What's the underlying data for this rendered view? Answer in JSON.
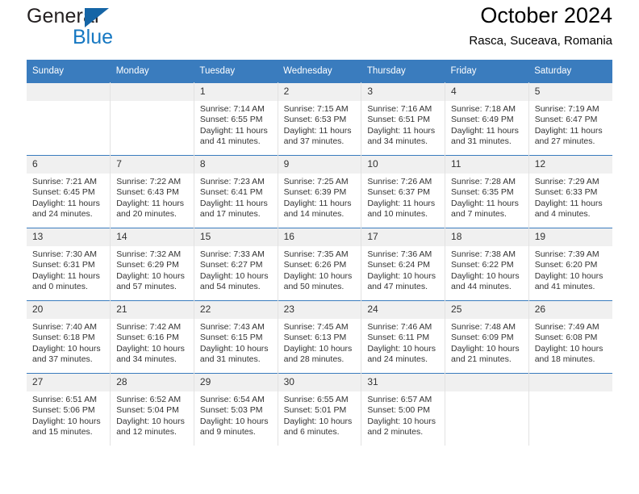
{
  "brand": {
    "name_top": "General",
    "name_bottom": "Blue",
    "triangle_color": "#1565a6",
    "blue_color": "#1678c2"
  },
  "header": {
    "title": "October 2024",
    "subtitle": "Rasca, Suceava, Romania"
  },
  "theme": {
    "header_bg": "#3a7cbe",
    "daynum_bg": "#f0f0f0",
    "cell_border": "#e2e2e2",
    "week_rule": "#3a7cbe"
  },
  "calendar": {
    "weekday_headers": [
      "Sunday",
      "Monday",
      "Tuesday",
      "Wednesday",
      "Thursday",
      "Friday",
      "Saturday"
    ],
    "labels": {
      "sunrise": "Sunrise:",
      "sunset": "Sunset:",
      "daylight": "Daylight:"
    },
    "weeks": [
      [
        {
          "day": "",
          "sunrise": "",
          "sunset": "",
          "daylight_line1": "",
          "daylight_line2": ""
        },
        {
          "day": "",
          "sunrise": "",
          "sunset": "",
          "daylight_line1": "",
          "daylight_line2": ""
        },
        {
          "day": "1",
          "sunrise": "Sunrise: 7:14 AM",
          "sunset": "Sunset: 6:55 PM",
          "daylight_line1": "Daylight: 11 hours",
          "daylight_line2": "and 41 minutes."
        },
        {
          "day": "2",
          "sunrise": "Sunrise: 7:15 AM",
          "sunset": "Sunset: 6:53 PM",
          "daylight_line1": "Daylight: 11 hours",
          "daylight_line2": "and 37 minutes."
        },
        {
          "day": "3",
          "sunrise": "Sunrise: 7:16 AM",
          "sunset": "Sunset: 6:51 PM",
          "daylight_line1": "Daylight: 11 hours",
          "daylight_line2": "and 34 minutes."
        },
        {
          "day": "4",
          "sunrise": "Sunrise: 7:18 AM",
          "sunset": "Sunset: 6:49 PM",
          "daylight_line1": "Daylight: 11 hours",
          "daylight_line2": "and 31 minutes."
        },
        {
          "day": "5",
          "sunrise": "Sunrise: 7:19 AM",
          "sunset": "Sunset: 6:47 PM",
          "daylight_line1": "Daylight: 11 hours",
          "daylight_line2": "and 27 minutes."
        }
      ],
      [
        {
          "day": "6",
          "sunrise": "Sunrise: 7:21 AM",
          "sunset": "Sunset: 6:45 PM",
          "daylight_line1": "Daylight: 11 hours",
          "daylight_line2": "and 24 minutes."
        },
        {
          "day": "7",
          "sunrise": "Sunrise: 7:22 AM",
          "sunset": "Sunset: 6:43 PM",
          "daylight_line1": "Daylight: 11 hours",
          "daylight_line2": "and 20 minutes."
        },
        {
          "day": "8",
          "sunrise": "Sunrise: 7:23 AM",
          "sunset": "Sunset: 6:41 PM",
          "daylight_line1": "Daylight: 11 hours",
          "daylight_line2": "and 17 minutes."
        },
        {
          "day": "9",
          "sunrise": "Sunrise: 7:25 AM",
          "sunset": "Sunset: 6:39 PM",
          "daylight_line1": "Daylight: 11 hours",
          "daylight_line2": "and 14 minutes."
        },
        {
          "day": "10",
          "sunrise": "Sunrise: 7:26 AM",
          "sunset": "Sunset: 6:37 PM",
          "daylight_line1": "Daylight: 11 hours",
          "daylight_line2": "and 10 minutes."
        },
        {
          "day": "11",
          "sunrise": "Sunrise: 7:28 AM",
          "sunset": "Sunset: 6:35 PM",
          "daylight_line1": "Daylight: 11 hours",
          "daylight_line2": "and 7 minutes."
        },
        {
          "day": "12",
          "sunrise": "Sunrise: 7:29 AM",
          "sunset": "Sunset: 6:33 PM",
          "daylight_line1": "Daylight: 11 hours",
          "daylight_line2": "and 4 minutes."
        }
      ],
      [
        {
          "day": "13",
          "sunrise": "Sunrise: 7:30 AM",
          "sunset": "Sunset: 6:31 PM",
          "daylight_line1": "Daylight: 11 hours",
          "daylight_line2": "and 0 minutes."
        },
        {
          "day": "14",
          "sunrise": "Sunrise: 7:32 AM",
          "sunset": "Sunset: 6:29 PM",
          "daylight_line1": "Daylight: 10 hours",
          "daylight_line2": "and 57 minutes."
        },
        {
          "day": "15",
          "sunrise": "Sunrise: 7:33 AM",
          "sunset": "Sunset: 6:27 PM",
          "daylight_line1": "Daylight: 10 hours",
          "daylight_line2": "and 54 minutes."
        },
        {
          "day": "16",
          "sunrise": "Sunrise: 7:35 AM",
          "sunset": "Sunset: 6:26 PM",
          "daylight_line1": "Daylight: 10 hours",
          "daylight_line2": "and 50 minutes."
        },
        {
          "day": "17",
          "sunrise": "Sunrise: 7:36 AM",
          "sunset": "Sunset: 6:24 PM",
          "daylight_line1": "Daylight: 10 hours",
          "daylight_line2": "and 47 minutes."
        },
        {
          "day": "18",
          "sunrise": "Sunrise: 7:38 AM",
          "sunset": "Sunset: 6:22 PM",
          "daylight_line1": "Daylight: 10 hours",
          "daylight_line2": "and 44 minutes."
        },
        {
          "day": "19",
          "sunrise": "Sunrise: 7:39 AM",
          "sunset": "Sunset: 6:20 PM",
          "daylight_line1": "Daylight: 10 hours",
          "daylight_line2": "and 41 minutes."
        }
      ],
      [
        {
          "day": "20",
          "sunrise": "Sunrise: 7:40 AM",
          "sunset": "Sunset: 6:18 PM",
          "daylight_line1": "Daylight: 10 hours",
          "daylight_line2": "and 37 minutes."
        },
        {
          "day": "21",
          "sunrise": "Sunrise: 7:42 AM",
          "sunset": "Sunset: 6:16 PM",
          "daylight_line1": "Daylight: 10 hours",
          "daylight_line2": "and 34 minutes."
        },
        {
          "day": "22",
          "sunrise": "Sunrise: 7:43 AM",
          "sunset": "Sunset: 6:15 PM",
          "daylight_line1": "Daylight: 10 hours",
          "daylight_line2": "and 31 minutes."
        },
        {
          "day": "23",
          "sunrise": "Sunrise: 7:45 AM",
          "sunset": "Sunset: 6:13 PM",
          "daylight_line1": "Daylight: 10 hours",
          "daylight_line2": "and 28 minutes."
        },
        {
          "day": "24",
          "sunrise": "Sunrise: 7:46 AM",
          "sunset": "Sunset: 6:11 PM",
          "daylight_line1": "Daylight: 10 hours",
          "daylight_line2": "and 24 minutes."
        },
        {
          "day": "25",
          "sunrise": "Sunrise: 7:48 AM",
          "sunset": "Sunset: 6:09 PM",
          "daylight_line1": "Daylight: 10 hours",
          "daylight_line2": "and 21 minutes."
        },
        {
          "day": "26",
          "sunrise": "Sunrise: 7:49 AM",
          "sunset": "Sunset: 6:08 PM",
          "daylight_line1": "Daylight: 10 hours",
          "daylight_line2": "and 18 minutes."
        }
      ],
      [
        {
          "day": "27",
          "sunrise": "Sunrise: 6:51 AM",
          "sunset": "Sunset: 5:06 PM",
          "daylight_line1": "Daylight: 10 hours",
          "daylight_line2": "and 15 minutes."
        },
        {
          "day": "28",
          "sunrise": "Sunrise: 6:52 AM",
          "sunset": "Sunset: 5:04 PM",
          "daylight_line1": "Daylight: 10 hours",
          "daylight_line2": "and 12 minutes."
        },
        {
          "day": "29",
          "sunrise": "Sunrise: 6:54 AM",
          "sunset": "Sunset: 5:03 PM",
          "daylight_line1": "Daylight: 10 hours",
          "daylight_line2": "and 9 minutes."
        },
        {
          "day": "30",
          "sunrise": "Sunrise: 6:55 AM",
          "sunset": "Sunset: 5:01 PM",
          "daylight_line1": "Daylight: 10 hours",
          "daylight_line2": "and 6 minutes."
        },
        {
          "day": "31",
          "sunrise": "Sunrise: 6:57 AM",
          "sunset": "Sunset: 5:00 PM",
          "daylight_line1": "Daylight: 10 hours",
          "daylight_line2": "and 2 minutes."
        },
        {
          "day": "",
          "sunrise": "",
          "sunset": "",
          "daylight_line1": "",
          "daylight_line2": ""
        },
        {
          "day": "",
          "sunrise": "",
          "sunset": "",
          "daylight_line1": "",
          "daylight_line2": ""
        }
      ]
    ]
  }
}
